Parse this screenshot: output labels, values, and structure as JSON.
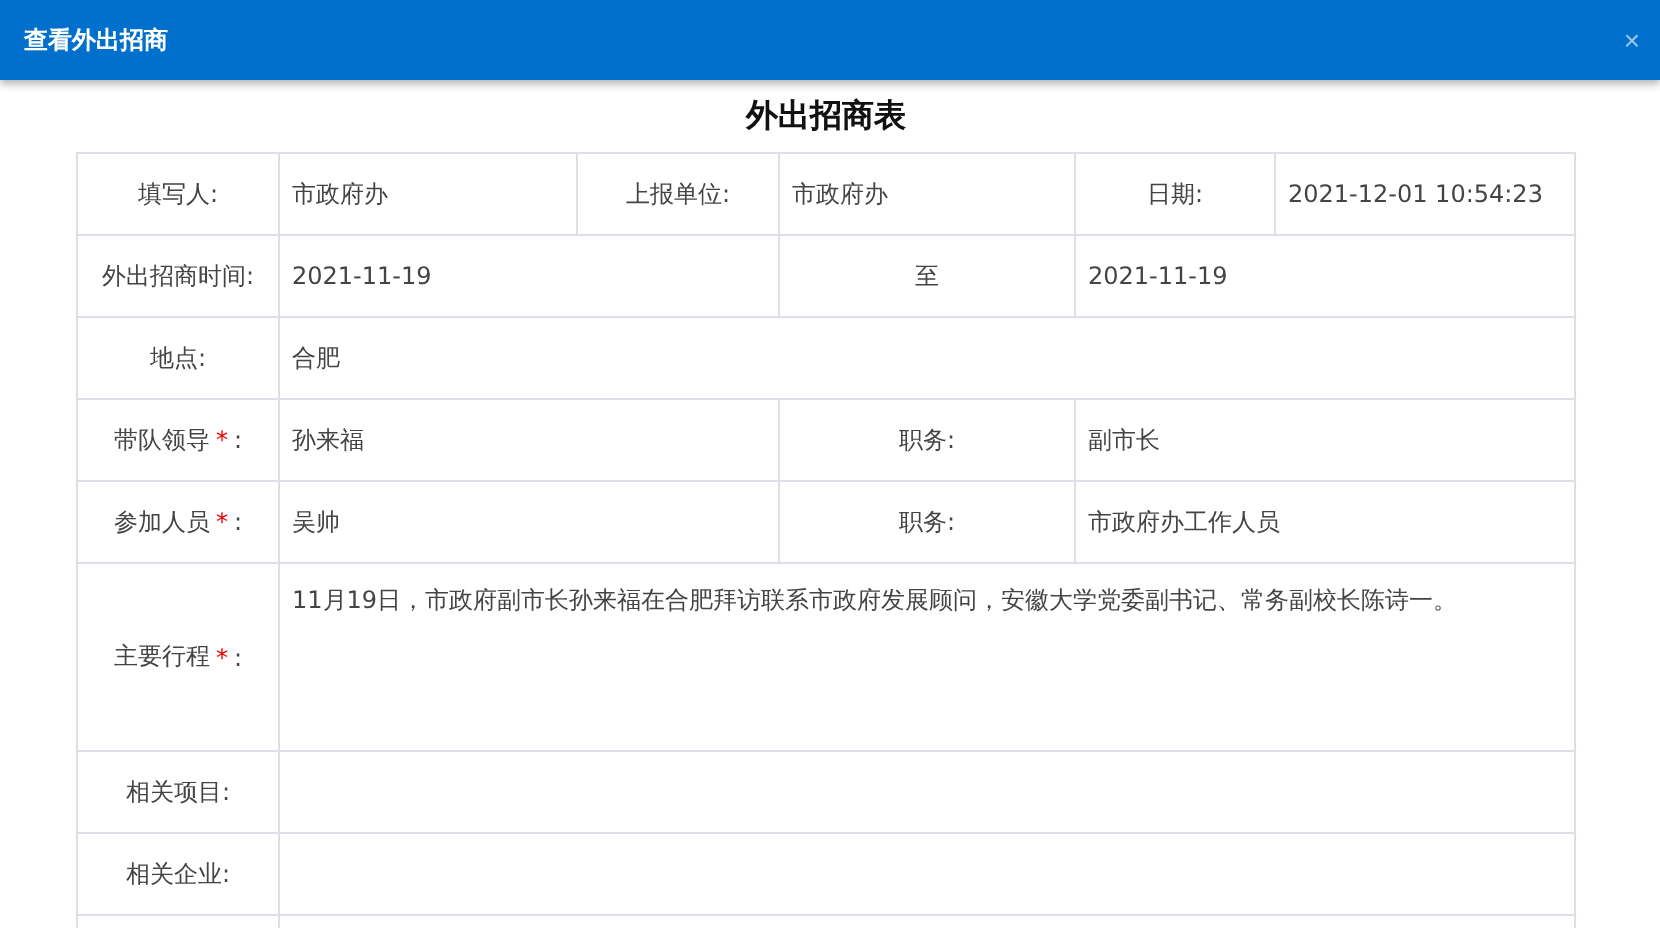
{
  "window": {
    "title": "查看外出招商",
    "close": "×"
  },
  "form": {
    "title": "外出招商表",
    "header_row": [
      {
        "kind": "label",
        "text": "填写人:"
      },
      {
        "kind": "value",
        "text": "市政府办"
      },
      {
        "kind": "label",
        "text": "上报单位:"
      },
      {
        "kind": "value",
        "text": "市政府办"
      },
      {
        "kind": "label",
        "text": "日期:"
      },
      {
        "kind": "value",
        "text": "2021-12-01 10:54:23"
      }
    ],
    "rows": [
      {
        "kind": "split",
        "cells": [
          {
            "kind": "label",
            "text": "外出招商时间:"
          },
          {
            "kind": "value",
            "text": "2021-11-19"
          },
          {
            "kind": "label",
            "text": "至"
          },
          {
            "kind": "value",
            "text": "2021-11-19"
          }
        ]
      },
      {
        "kind": "full",
        "cells": [
          {
            "kind": "label",
            "text": "地点:"
          },
          {
            "kind": "value",
            "text": "合肥"
          }
        ]
      },
      {
        "kind": "split",
        "cells": [
          {
            "kind": "label",
            "text": "带队领导",
            "asterisk": "*",
            "colon": ":"
          },
          {
            "kind": "value",
            "text": "孙来福"
          },
          {
            "kind": "label",
            "text": "职务:"
          },
          {
            "kind": "value",
            "text": "副市长"
          }
        ]
      },
      {
        "kind": "split",
        "cells": [
          {
            "kind": "label",
            "text": "参加人员",
            "asterisk": "*",
            "colon": ":"
          },
          {
            "kind": "value",
            "text": "吴帅"
          },
          {
            "kind": "label",
            "text": "职务:"
          },
          {
            "kind": "value",
            "text": "市政府办工作人员"
          }
        ]
      },
      {
        "kind": "full_tall",
        "cells": [
          {
            "kind": "label",
            "text": "主要行程",
            "asterisk": "*",
            "colon": ":"
          },
          {
            "kind": "value",
            "text": "11月19日，市政府副市长孙来福在合肥拜访联系市政府发展顾问，安徽大学党委副书记、常务副校长陈诗一。"
          }
        ]
      },
      {
        "kind": "full",
        "cells": [
          {
            "kind": "label",
            "text": "相关项目:"
          },
          {
            "kind": "value",
            "text": ""
          }
        ]
      },
      {
        "kind": "full",
        "cells": [
          {
            "kind": "label",
            "text": "相关企业:"
          },
          {
            "kind": "value",
            "text": ""
          }
        ]
      }
    ]
  }
}
